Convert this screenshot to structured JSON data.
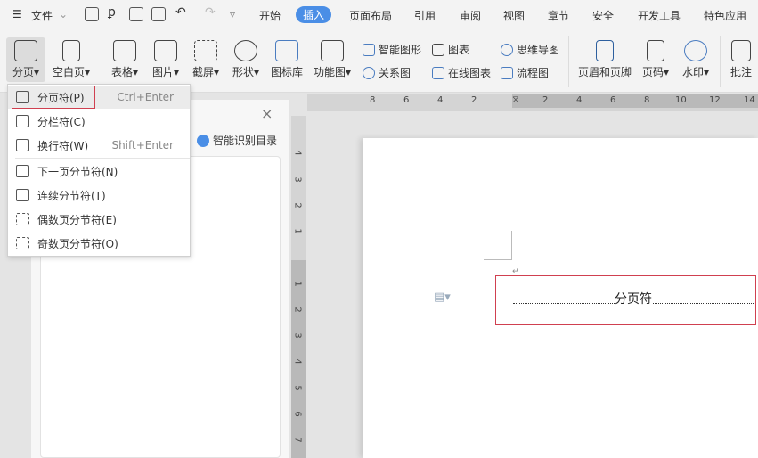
{
  "topbar": {
    "file_menu": "文件",
    "tabs": [
      "开始",
      "插入",
      "页面布局",
      "引用",
      "审阅",
      "视图",
      "章节",
      "安全",
      "开发工具",
      "特色应用"
    ],
    "active_tab": "插入"
  },
  "ribbon": {
    "large": [
      "分页",
      "空白页",
      "表格",
      "图片",
      "截屏",
      "形状",
      "图标库",
      "功能图"
    ],
    "small": [
      "智能图形",
      "图表",
      "思维导图",
      "关系图",
      "在线图表",
      "流程图"
    ],
    "large2": [
      "页眉和页脚",
      "页码",
      "水印",
      "批注"
    ]
  },
  "dropdown": {
    "items": [
      {
        "label": "分页符(P)",
        "shortcut": "Ctrl+Enter"
      },
      {
        "label": "分栏符(C)",
        "shortcut": ""
      },
      {
        "label": "换行符(W)",
        "shortcut": "Shift+Enter"
      },
      {
        "label": "下一页分节符(N)",
        "shortcut": ""
      },
      {
        "label": "连续分节符(T)",
        "shortcut": ""
      },
      {
        "label": "偶数页分节符(E)",
        "shortcut": ""
      },
      {
        "label": "奇数页分节符(O)",
        "shortcut": ""
      }
    ]
  },
  "pane": {
    "smart_toc": "智能识别目录",
    "close": "×"
  },
  "hruler": [
    "8",
    "6",
    "4",
    "2",
    "2",
    "4",
    "6",
    "8",
    "10",
    "12",
    "14"
  ],
  "vruler": [
    "4",
    "3",
    "2",
    "1",
    "1",
    "2",
    "3",
    "4",
    "5",
    "6",
    "7"
  ],
  "document": {
    "page_break_label": "分页符"
  },
  "colors": {
    "accent": "#4a8ee6",
    "highlight": "#d9383a"
  }
}
